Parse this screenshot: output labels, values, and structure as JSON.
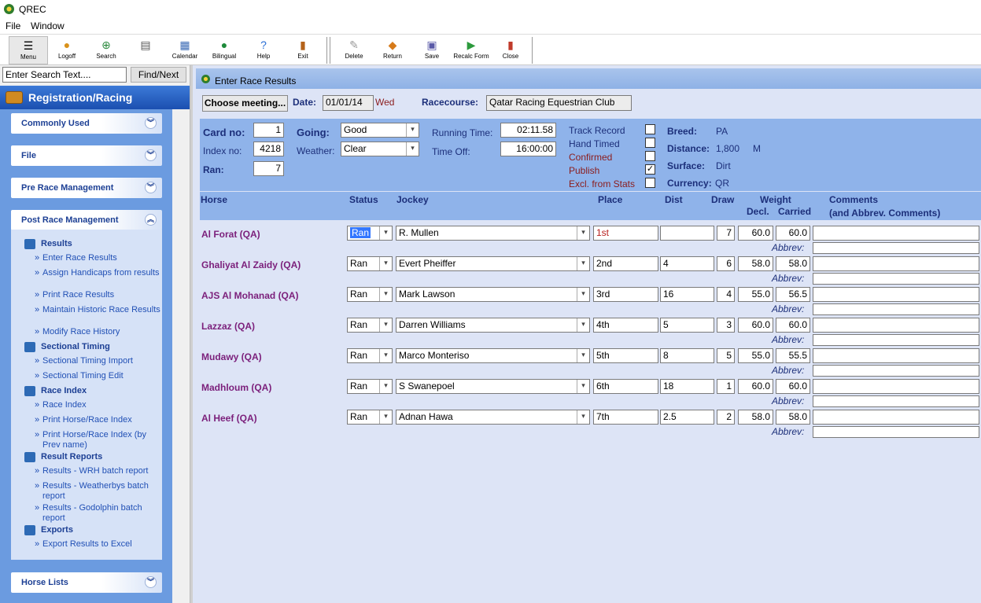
{
  "app": {
    "title": "QREC"
  },
  "menu": {
    "file": "File",
    "window": "Window"
  },
  "toolbar": {
    "menu": "Menu",
    "logoff": "Logoff",
    "search": "Search",
    "blank": "",
    "calendar": "Calendar",
    "bilingual": "Bilingual",
    "help": "Help",
    "exit": "Exit",
    "delete": "Delete",
    "return": "Return",
    "save": "Save",
    "recalc": "Recalc Form",
    "close": "Close"
  },
  "leftpane": {
    "search_placeholder": "Enter Search Text....",
    "find_next": "Find/Next",
    "header": "Registration/Racing",
    "groups": {
      "commonly_used": "Commonly Used",
      "file": "File",
      "pre_race": "Pre Race Management",
      "post_race": "Post Race Management",
      "horse_lists": "Horse Lists"
    },
    "sections": {
      "results": "Results",
      "sectional": "Sectional Timing",
      "race_index": "Race Index",
      "result_reports": "Result Reports",
      "exports": "Exports"
    },
    "links": {
      "enter_results": "Enter Race Results",
      "assign_handicaps": "Assign Handicaps from results",
      "print_results": "Print Race Results",
      "maintain_historic": "Maintain Historic Race Results",
      "modify_history": "Modify Race History",
      "sect_import": "Sectional Timing Import",
      "sect_edit": "Sectional Timing Edit",
      "race_index": "Race Index",
      "print_hri": "Print Horse/Race Index",
      "print_hri_prev": "Print Horse/Race Index (by Prev name)",
      "wrh_batch": "Results - WRH batch report",
      "weatherbys": "Results - Weatherbys batch report",
      "godolphin": "Results - Godolphin batch report",
      "export_excel": "Export Results to Excel"
    }
  },
  "main": {
    "window_title": "Enter Race Results",
    "choose_meeting": "Choose meeting...",
    "date_label": "Date:",
    "date_value": "01/01/14",
    "day": "Wed",
    "racecourse_label": "Racecourse:",
    "racecourse_value": "Qatar Racing  Equestrian Club",
    "card_no_label": "Card no:",
    "card_no": "1",
    "index_no_label": "Index no:",
    "index_no": "4218",
    "ran_label": "Ran:",
    "ran": "7",
    "going_label": "Going:",
    "going": "Good",
    "weather_label": "Weather:",
    "weather": "Clear",
    "running_time_label": "Running Time:",
    "running_time": "02:11.58",
    "time_off_label": "Time Off:",
    "time_off": "16:00:00",
    "track_record": "Track Record",
    "hand_timed": "Hand Timed",
    "confirmed": "Confirmed",
    "publish": "Publish",
    "excl_stats": "Excl. from Stats",
    "publish_check": "✓",
    "breed_label": "Breed:",
    "breed": "PA",
    "distance_label": "Distance:",
    "distance": "1,800",
    "distance_unit": "M",
    "surface_label": "Surface:",
    "surface": "Dirt",
    "currency_label": "Currency:",
    "currency": "QR"
  },
  "columns": {
    "horse": "Horse",
    "status": "Status",
    "jockey": "Jockey",
    "place": "Place",
    "dist": "Dist",
    "draw": "Draw",
    "weight": "Weight",
    "decl": "Decl.",
    "carried": "Carried",
    "comments": "Comments",
    "comments_sub": "(and Abbrev. Comments)",
    "abbrev": "Abbrev:"
  },
  "rows": [
    {
      "horse": "Al Forat (QA)",
      "status": "Ran",
      "jockey": "R. Mullen",
      "place": "1st",
      "dist": "",
      "draw": "7",
      "decl": "60.0",
      "carried": "60.0"
    },
    {
      "horse": "Ghaliyat Al Zaidy (QA)",
      "status": "Ran",
      "jockey": "Evert Pheiffer",
      "place": "2nd",
      "dist": "4",
      "draw": "6",
      "decl": "58.0",
      "carried": "58.0"
    },
    {
      "horse": "AJS Al Mohanad (QA)",
      "status": "Ran",
      "jockey": "Mark Lawson",
      "place": "3rd",
      "dist": "16",
      "draw": "4",
      "decl": "55.0",
      "carried": "56.5"
    },
    {
      "horse": "Lazzaz (QA)",
      "status": "Ran",
      "jockey": "Darren Williams",
      "place": "4th",
      "dist": "5",
      "draw": "3",
      "decl": "60.0",
      "carried": "60.0"
    },
    {
      "horse": "Mudawy (QA)",
      "status": "Ran",
      "jockey": "Marco Monteriso",
      "place": "5th",
      "dist": "8",
      "draw": "5",
      "decl": "55.0",
      "carried": "55.5"
    },
    {
      "horse": "Madhloum (QA)",
      "status": "Ran",
      "jockey": "S Swanepoel",
      "place": "6th",
      "dist": "18",
      "draw": "1",
      "decl": "60.0",
      "carried": "60.0"
    },
    {
      "horse": "Al Heef (QA)",
      "status": "Ran",
      "jockey": "Adnan Hawa",
      "place": "7th",
      "dist": "2.5",
      "draw": "2",
      "decl": "58.0",
      "carried": "58.0"
    }
  ]
}
